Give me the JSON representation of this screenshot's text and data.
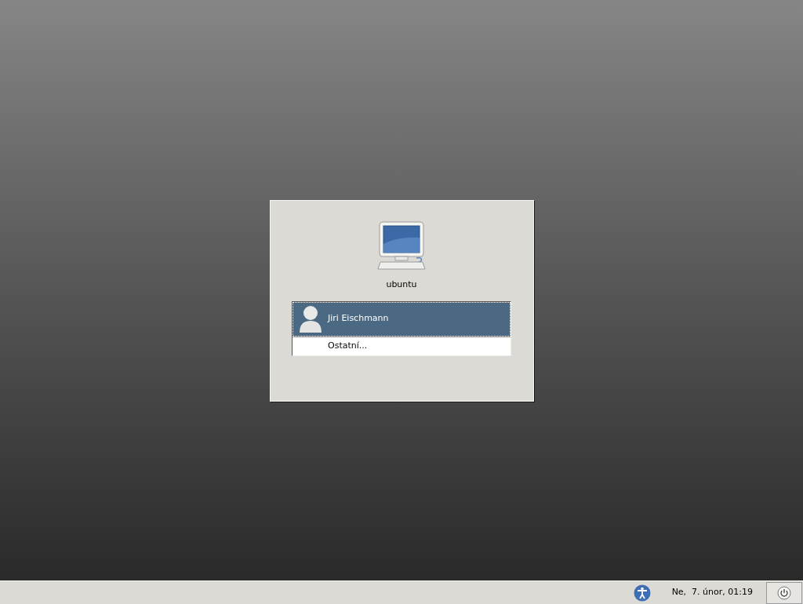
{
  "login_dialog": {
    "hostname": "ubuntu",
    "users": [
      {
        "kind": "user",
        "name": "Jiri Eischmann",
        "selected": true
      },
      {
        "kind": "other",
        "name": "Ostatní...",
        "selected": false
      }
    ]
  },
  "panel": {
    "clock": "Ne,  7. únor, 01:19"
  }
}
